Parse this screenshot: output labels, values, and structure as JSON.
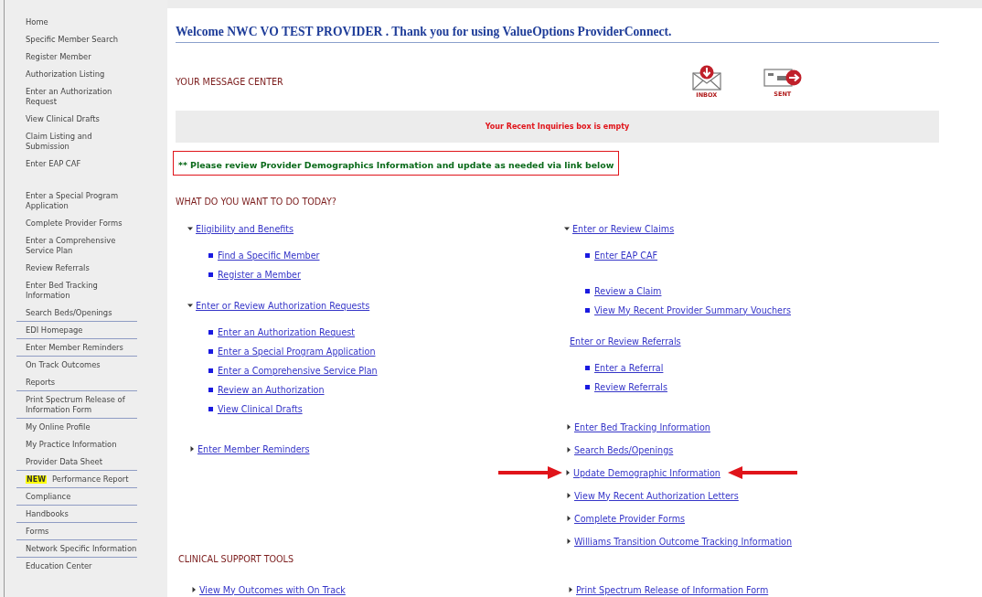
{
  "sidebar": {
    "sections": [
      {
        "items": [
          {
            "label": "Home",
            "ruled": false
          },
          {
            "label": "Specific Member Search",
            "ruled": false
          },
          {
            "label": "Register Member",
            "ruled": false
          },
          {
            "label": "Authorization Listing",
            "ruled": false
          },
          {
            "label": "Enter an Authorization Request",
            "ruled": false
          },
          {
            "label": "View Clinical Drafts",
            "ruled": false
          },
          {
            "label": "Claim Listing and Submission",
            "ruled": false
          },
          {
            "label": "Enter EAP CAF",
            "ruled": false
          }
        ]
      },
      {
        "items": [
          {
            "label": "Enter a Special Program Application",
            "ruled": false
          },
          {
            "label": "Complete Provider Forms",
            "ruled": false
          },
          {
            "label": "Enter a Comprehensive Service Plan",
            "ruled": false
          },
          {
            "label": "Review Referrals",
            "ruled": false
          },
          {
            "label": "Enter Bed Tracking Information",
            "ruled": false
          },
          {
            "label": "Search Beds/Openings",
            "ruled": true
          },
          {
            "label": "EDI Homepage",
            "ruled": true
          },
          {
            "label": "Enter Member Reminders",
            "ruled": true
          },
          {
            "label": "On Track Outcomes",
            "ruled": false
          },
          {
            "label": "Reports",
            "ruled": true
          },
          {
            "label": "Print Spectrum Release of Information Form",
            "ruled": true
          },
          {
            "label": "My Online Profile",
            "ruled": false
          },
          {
            "label": "My Practice Information",
            "ruled": false
          },
          {
            "label": "Provider Data Sheet",
            "ruled": true
          },
          {
            "label": "Performance Report",
            "badge": "NEW",
            "ruled": true
          },
          {
            "label": "Compliance",
            "ruled": true
          },
          {
            "label": "Handbooks",
            "ruled": true
          },
          {
            "label": "Forms",
            "ruled": true
          },
          {
            "label": "Network Specific Information",
            "ruled": true
          },
          {
            "label": "Education Center",
            "ruled": false
          }
        ]
      }
    ]
  },
  "header": {
    "title": "Welcome NWC VO TEST PROVIDER . Thank you for using ValueOptions ProviderConnect."
  },
  "message_center": {
    "title": "YOUR MESSAGE CENTER",
    "inbox_label": "INBOX",
    "sent_label": "SENT",
    "inquiries": "Your Recent Inquiries box is empty"
  },
  "notice": "** Please review Provider Demographics Information and update as needed via link below",
  "tasks": {
    "title": "WHAT DO YOU WANT TO DO TODAY?",
    "columns": [
      [
        {
          "kind": "group",
          "label": "Eligibility and Benefits",
          "expanded": true,
          "link_groups": [
            [
              "Find a Specific Member",
              "Register a Member"
            ]
          ]
        },
        {
          "kind": "group",
          "label": "Enter or Review Authorization Requests",
          "expanded": true,
          "link_groups": [
            [
              "Enter an Authorization Request",
              "Enter a Special Program Application",
              "Enter a Comprehensive Service Plan",
              "Review an Authorization",
              "View Clinical Drafts"
            ]
          ]
        },
        {
          "kind": "link",
          "label": "Enter Member Reminders",
          "highlighted": false
        }
      ],
      [
        {
          "kind": "group",
          "label": "Enter or Review Claims",
          "expanded": true,
          "link_groups": [
            [
              "Enter EAP CAF"
            ],
            [
              "Review a Claim",
              "View My Recent Provider Summary Vouchers"
            ]
          ]
        },
        {
          "kind": "heading",
          "label": "Enter or Review Referrals",
          "link_groups": [
            [
              "Enter a Referral",
              "Review Referrals"
            ]
          ]
        },
        {
          "kind": "link",
          "label": "Enter Bed Tracking Information",
          "highlighted": false
        },
        {
          "kind": "link",
          "label": "Search Beds/Openings",
          "highlighted": false
        },
        {
          "kind": "link",
          "label": "Update Demographic Information",
          "highlighted": true
        },
        {
          "kind": "link",
          "label": "View My Recent Authorization Letters",
          "highlighted": false
        },
        {
          "kind": "link",
          "label": "Complete Provider Forms",
          "highlighted": false
        },
        {
          "kind": "link",
          "label": "Williams Transition Outcome Tracking Information",
          "highlighted": false
        }
      ]
    ]
  },
  "clinical_tools": {
    "title": "CLINICAL SUPPORT TOOLS",
    "links": [
      "View My Outcomes with On Track",
      "Print Spectrum Release of Information Form"
    ]
  }
}
